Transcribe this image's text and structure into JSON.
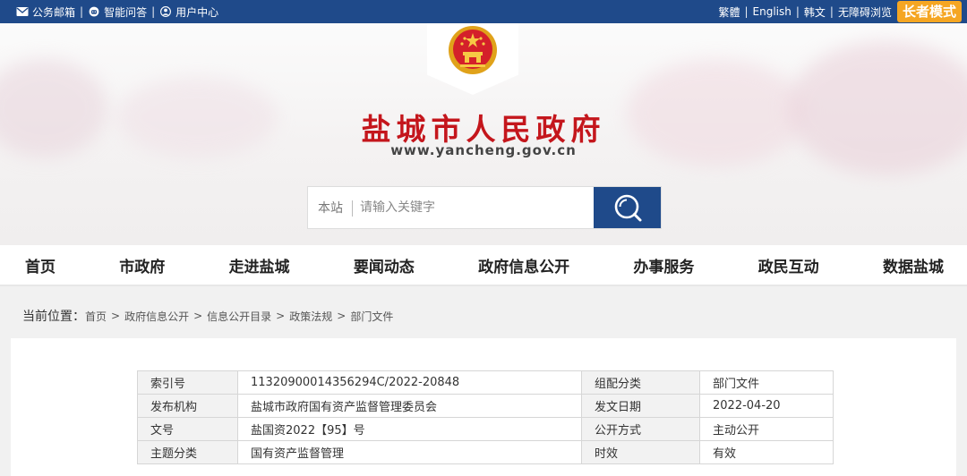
{
  "topbar": {
    "mail": "公务邮箱",
    "qa": "智能问答",
    "user_center": "用户中心",
    "traditional": "繁體",
    "english": "English",
    "korean": "韩文",
    "accessible": "无障碍浏览",
    "elder_mode": "长者模式"
  },
  "header": {
    "title": "盐城市人民政府",
    "url": "www.yancheng.gov.cn"
  },
  "search": {
    "scope": "本站",
    "placeholder": "请输入关键字"
  },
  "nav": [
    "首页",
    "市政府",
    "走进盐城",
    "要闻动态",
    "政府信息公开",
    "办事服务",
    "政民互动",
    "数据盐城"
  ],
  "breadcrumb": {
    "label": "当前位置：",
    "items": [
      "首页",
      "政府信息公开",
      "信息公开目录",
      "政策法规",
      "部门文件"
    ]
  },
  "meta_table": [
    [
      "索引号",
      "11320900014356294C/2022-20848",
      "组配分类",
      "部门文件"
    ],
    [
      "发布机构",
      "盐城市政府国有资产监督管理委员会",
      "发文日期",
      "2022-04-20"
    ],
    [
      "文号",
      "盐国资2022【95】号",
      "公开方式",
      "主动公开"
    ],
    [
      "主题分类",
      "国有资产监督管理",
      "时效",
      "有效"
    ]
  ],
  "colors": {
    "brand_blue": "#1f4a8a",
    "title_red": "#c4161c",
    "elder_orange": "#f5a623"
  }
}
